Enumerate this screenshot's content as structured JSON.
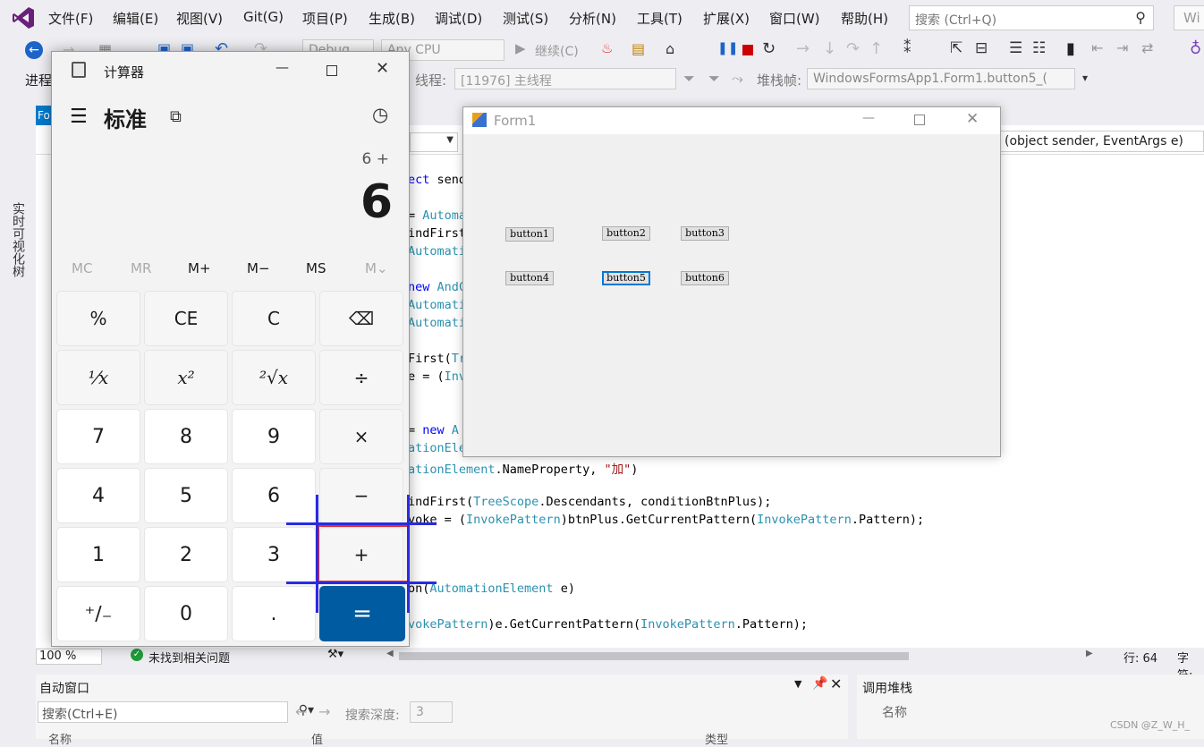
{
  "menubar": {
    "items": [
      "文件(F)",
      "编辑(E)",
      "视图(V)",
      "Git(G)",
      "项目(P)",
      "生成(B)",
      "调试(D)",
      "测试(S)",
      "分析(N)",
      "工具(T)",
      "扩展(X)",
      "窗口(W)",
      "帮助(H)"
    ],
    "search_placeholder": "搜索 (Ctrl+Q)",
    "right_tab": "Wi"
  },
  "toolbar": {
    "config": "Debug",
    "platform": "Any CPU",
    "continue_label": "继续(C)",
    "process_label": "进程",
    "thread_label": "线程:",
    "thread_value": "[11976] 主线程",
    "stackframe_label": "堆栈帧:",
    "stackframe_value": "WindowsFormsApp1.Form1.button5_("
  },
  "left_strip": {
    "vertical_label": "实时可视化树",
    "tab_label": "Fo"
  },
  "editor": {
    "member_combo": "(object sender, EventArgs e)",
    "lines": [
      {
        "kw": "ect",
        "rest": " send"
      },
      {
        "rest": "= ",
        "ty": "Automa"
      },
      {
        "rest": "indFirst"
      },
      {
        "ty": "Automati"
      },
      {
        "kw": "new",
        "ty": " AndC"
      },
      {
        "ty": "Automati"
      },
      {
        "ty": "Automati"
      },
      {
        "rest": "First(",
        "ty": "Tr"
      },
      {
        "rest": "e = (",
        "ty": "Inv"
      },
      {
        "rest": "= ",
        "kw": "new",
        "ty": " A"
      },
      {
        "ty": "ationEle"
      },
      {
        "ty": "ationElement",
        "rest": ".NameProperty, ",
        "st": "\"加\"",
        "rest2": ")"
      },
      {
        "rest": "indFirst(",
        "ty": "TreeScope",
        "rest2": ".Descendants, conditionBtnPlus);"
      },
      {
        "rest": "voke = (",
        "ty": "InvokePattern",
        "rest2": ")btnPlus.GetCurrentPattern(",
        "ty2": "InvokePattern",
        "rest3": ".Pattern);"
      },
      {
        "rest": "on(",
        "ty": "AutomationElement",
        "rest2": " e)"
      },
      {
        "ty": "vokePattern",
        "rest": ")e.GetCurrentPattern(",
        "ty2": "InvokePattern",
        "rest2": ".Pattern);"
      }
    ]
  },
  "statusbar": {
    "zoom": "100 %",
    "issues": "未找到相关问题",
    "line": "行: 64",
    "char": "字符:"
  },
  "auto_window": {
    "title": "自动窗口",
    "search_placeholder": "搜索(Ctrl+E)",
    "depth_label": "搜索深度:",
    "depth_value": "3",
    "col_name": "名称",
    "col_value": "值",
    "col_type": "类型"
  },
  "callstack": {
    "title": "调用堆栈",
    "col_name": "名称"
  },
  "calculator": {
    "title": "计算器",
    "mode": "标准",
    "expression": "6 +",
    "display": "6",
    "memory": [
      "MC",
      "MR",
      "M+",
      "M−",
      "MS",
      "M⌄"
    ],
    "keys": [
      [
        "%",
        "CE",
        "C",
        "⌫"
      ],
      [
        "¹⁄x",
        "x²",
        "²√x",
        "÷"
      ],
      [
        "7",
        "8",
        "9",
        "×"
      ],
      [
        "4",
        "5",
        "6",
        "−"
      ],
      [
        "1",
        "2",
        "3",
        "+"
      ],
      [
        "⁺∕₋",
        "0",
        ".",
        "="
      ]
    ]
  },
  "form1": {
    "title": "Form1",
    "buttons": [
      "button1",
      "button2",
      "button3",
      "button4",
      "button5",
      "button6"
    ]
  },
  "watermark": "CSDN @Z_W_H_",
  "colors": {
    "accent": "#005ba1",
    "highlight_red": "#e03030",
    "crosshair_blue": "#2a2ae0"
  }
}
